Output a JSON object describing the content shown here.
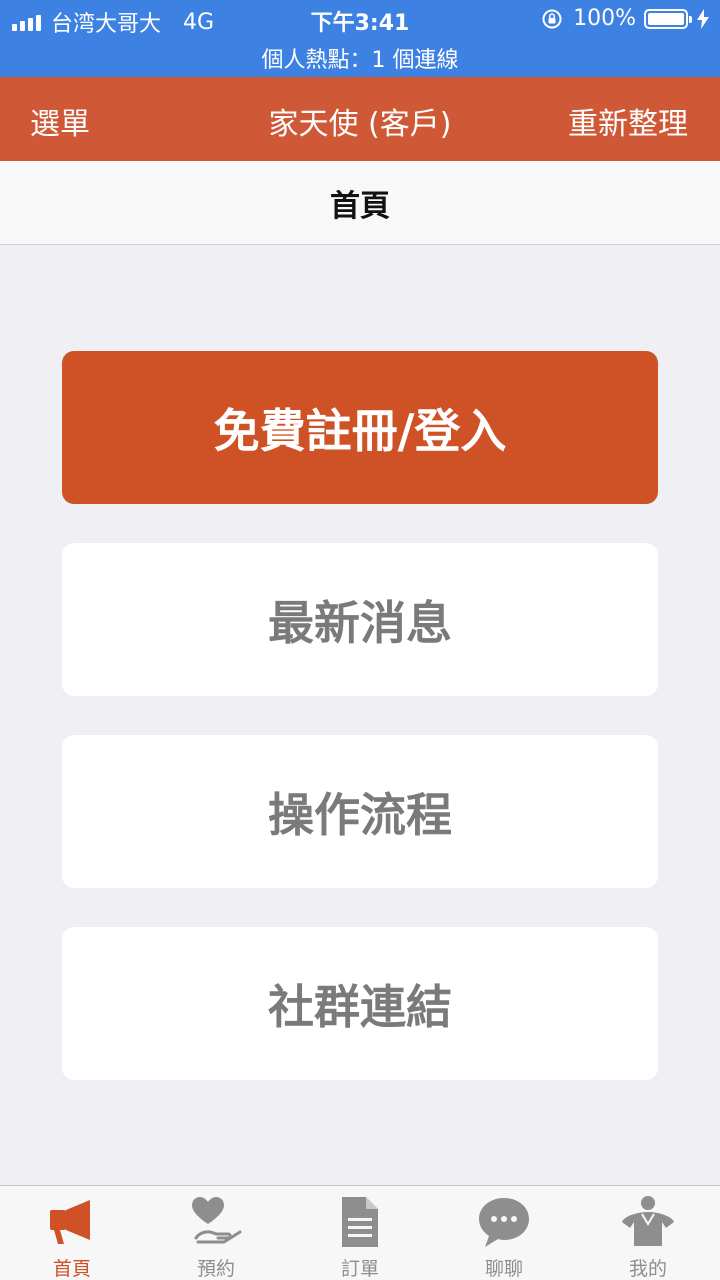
{
  "status_bar": {
    "carrier": "台湾大哥大",
    "network": "4G",
    "time": "下午3:41",
    "battery": "100%",
    "battery_level": 1.0,
    "hotspot": "個人熱點：1 個連線"
  },
  "nav": {
    "left_label": "選單",
    "title": "家天使 (客戶)",
    "right_label": "重新整理"
  },
  "subheader": {
    "title": "首頁"
  },
  "buttons": {
    "register_login": "免費註冊/登入",
    "news": "最新消息",
    "process": "操作流程",
    "social": "社群連結"
  },
  "tabs": [
    {
      "label": "首頁",
      "icon": "megaphone-icon",
      "active": true
    },
    {
      "label": "預約",
      "icon": "heart-hand-icon",
      "active": false
    },
    {
      "label": "訂單",
      "icon": "document-icon",
      "active": false
    },
    {
      "label": "聊聊",
      "icon": "chat-bubble-icon",
      "active": false
    },
    {
      "label": "我的",
      "icon": "person-icon",
      "active": false
    }
  ],
  "colors": {
    "status_bar": "#3d81e2",
    "brand": "#cf5936",
    "primary_button": "#cf5227",
    "tab_inactive": "#8e8e8e"
  }
}
